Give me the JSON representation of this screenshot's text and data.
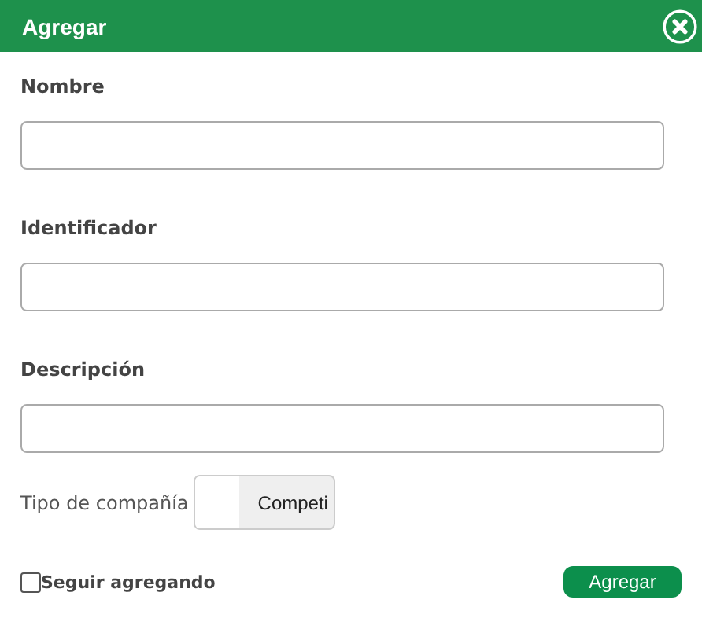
{
  "window": {
    "title": "Agregar"
  },
  "fields": [
    {
      "label": "Nombre"
    },
    {
      "label": "Identificador"
    },
    {
      "label": "Descripción"
    }
  ],
  "company_type": {
    "label": "Tipo de compañía",
    "switch_text": "Competi",
    "on": false
  },
  "keep_adding": {
    "label": "Seguir agregando",
    "checked": false
  },
  "buttons": [
    "Agregar"
  ]
}
